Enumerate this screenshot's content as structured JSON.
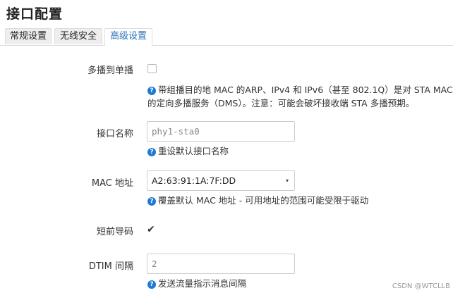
{
  "page": {
    "title": "接口配置"
  },
  "tabs": [
    {
      "label": "常规设置",
      "active": false
    },
    {
      "label": "无线安全",
      "active": false
    },
    {
      "label": "高级设置",
      "active": true
    }
  ],
  "fields": {
    "multicast": {
      "label": "多播到单播",
      "checked": false,
      "help_line1": "带组播目的地 MAC 的ARP、IPv4 和 IPv6（甚至 802.1Q）是对 STA MAC",
      "help_line2": "的定向多播服务（DMS）。注意：可能会破坏接收端 STA 多播预期。"
    },
    "ifname": {
      "label": "接口名称",
      "placeholder": "phy1-sta0",
      "help": "重设默认接口名称"
    },
    "mac": {
      "label": "MAC 地址",
      "value": "A2:63:91:1A:7F:DD",
      "help": "覆盖默认 MAC 地址 - 可用地址的范围可能受限于驱动"
    },
    "short_preamble": {
      "label": "短前导码",
      "checked": true
    },
    "dtim": {
      "label": "DTIM 间隔",
      "placeholder": "2",
      "help": "发送流量指示消息间隔"
    }
  },
  "icons": {
    "help": "help-circle-icon",
    "checkmark": "check-icon",
    "caret": "caret-down-icon"
  },
  "watermark": "CSDN @WTCLLB"
}
